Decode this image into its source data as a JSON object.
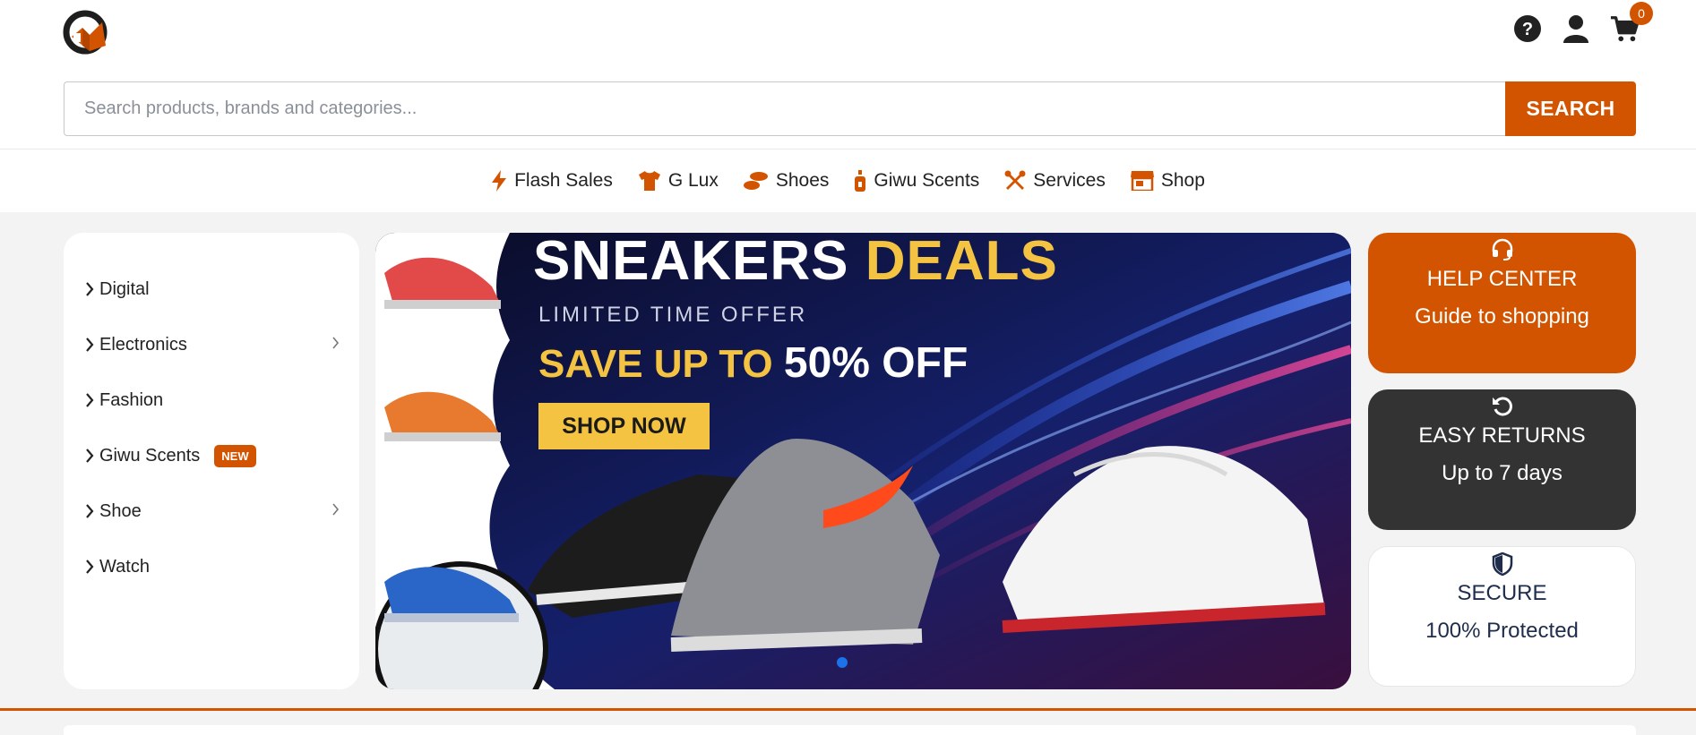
{
  "header": {
    "logo_icon": "brand-logo",
    "icons": [
      "help-icon",
      "user-icon",
      "cart-icon"
    ],
    "cart_count": "0",
    "accent_color": "#d35400"
  },
  "search": {
    "placeholder": "Search products, brands and categories...",
    "value": "",
    "button_label": "SEARCH"
  },
  "nav": {
    "items": [
      {
        "label": "Flash Sales",
        "icon": "bolt-icon"
      },
      {
        "label": "G Lux",
        "icon": "tshirt-icon"
      },
      {
        "label": "Shoes",
        "icon": "shoe-prints-icon"
      },
      {
        "label": "Giwu Scents",
        "icon": "perfume-bottle-icon"
      },
      {
        "label": "Services",
        "icon": "tools-icon"
      },
      {
        "label": "Shop",
        "icon": "store-icon"
      }
    ]
  },
  "categories": {
    "items": [
      {
        "label": "Digital",
        "has_submenu": false
      },
      {
        "label": "Electronics",
        "has_submenu": true
      },
      {
        "label": "Fashion",
        "has_submenu": false
      },
      {
        "label": "Giwu Scents",
        "has_submenu": false,
        "badge": "NEW"
      },
      {
        "label": "Shoe",
        "has_submenu": true
      },
      {
        "label": "Watch",
        "has_submenu": false
      }
    ]
  },
  "hero": {
    "title_main": "SNEAKERS",
    "title_accent": "DEALS",
    "subtitle": "LIMITED TIME OFFER",
    "save_prefix": "SAVE UP TO",
    "save_amount": "50% OFF",
    "cta_label": "SHOP NOW",
    "slide_count": 1,
    "active_slide": 1
  },
  "info_cards": {
    "help": {
      "icon": "headset-icon",
      "title": "HELP CENTER",
      "subtitle": "Guide to shopping",
      "color": "#d35400"
    },
    "returns": {
      "icon": "rotate-left-icon",
      "title": "EASY RETURNS",
      "subtitle": "Up to 7 days",
      "color": "#333333"
    },
    "secure": {
      "icon": "shield-icon",
      "title": "SECURE",
      "subtitle": "100% Protected",
      "color": "#ffffff"
    }
  }
}
